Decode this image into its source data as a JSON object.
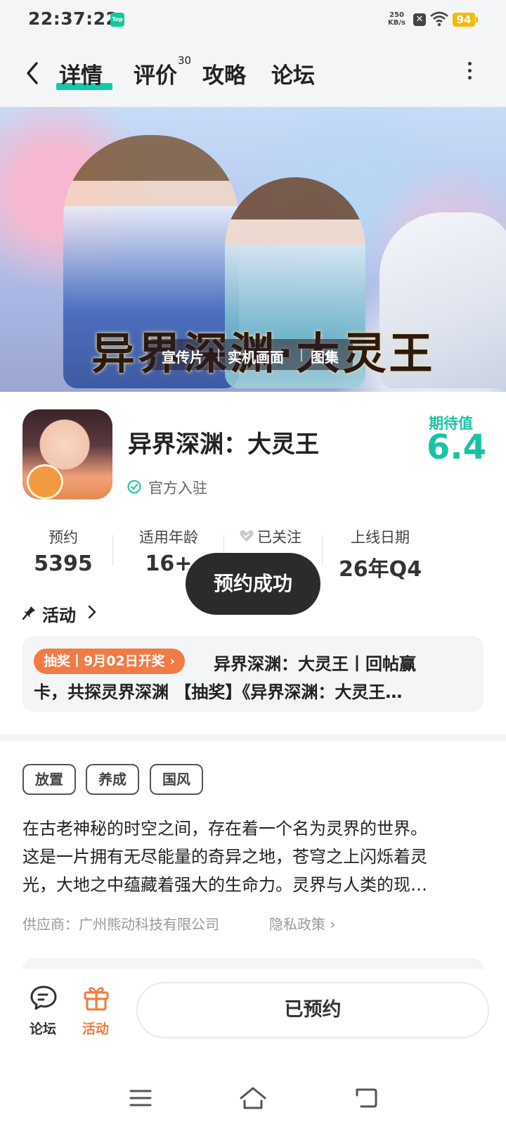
{
  "status_bar": {
    "time": "22:37:22",
    "app_badge": "Top",
    "net_speed_value": "250",
    "net_speed_unit": "KB/s",
    "battery": "94"
  },
  "nav": {
    "tabs": [
      {
        "label": "详情"
      },
      {
        "label": "评价"
      },
      {
        "label": "攻略"
      },
      {
        "label": "论坛"
      }
    ],
    "review_count": "30",
    "accent": "#14c9a7"
  },
  "banner": {
    "title_art": "异界深渊·大灵王",
    "media_tabs": [
      "宣传片",
      "实机画面",
      "图集"
    ]
  },
  "app": {
    "name": "异界深渊：大灵王",
    "verified_label": "官方入驻",
    "expect_label": "期待值",
    "expect_value": "6.4"
  },
  "stats": [
    {
      "label": "预约",
      "value": "5395"
    },
    {
      "label": "适用年龄",
      "value": "16+"
    },
    {
      "label": "已关注",
      "value": ""
    },
    {
      "label": "上线日期",
      "value": "26年Q4"
    }
  ],
  "toast": "预约成功",
  "activity": {
    "title": "活动",
    "badge": "抽奖丨9月02日开奖",
    "line1": "异界深渊：大灵王丨回帖赢",
    "line2": "卡，共探灵界深渊 【抽奖】《异界深渊：大灵王…"
  },
  "tags": [
    "放置",
    "养成",
    "国风"
  ],
  "description": [
    "在古老神秘的时空之间，存在着一个名为灵界的世界。",
    "这是一片拥有无尽能量的奇异之地，苍穹之上闪烁着灵",
    "光，大地之中蕴藏着强大的生命力。灵界与人类的现…"
  ],
  "supplier": "供应商：广州熊动科技有限公司",
  "privacy": "隐私政策",
  "bottom": {
    "forum_label": "论坛",
    "activity_label": "活动",
    "reserved_label": "已预约",
    "activity_color": "#f27a3a"
  }
}
